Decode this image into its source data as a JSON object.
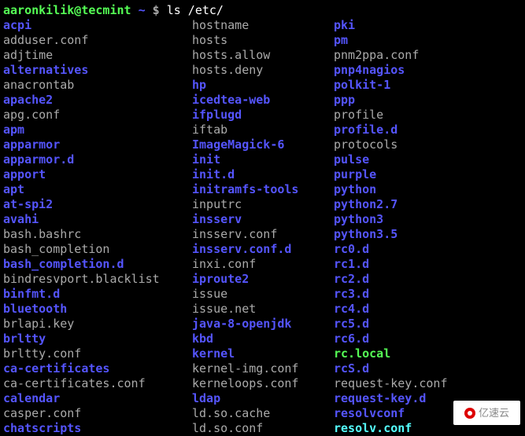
{
  "prompt": {
    "user": "aaronkilik@tecmint",
    "tilde": "~",
    "dollar": "$",
    "command": "ls /etc/"
  },
  "columns": [
    [
      {
        "name": "acpi",
        "cls": "f-dir"
      },
      {
        "name": "adduser.conf",
        "cls": "f-file"
      },
      {
        "name": "adjtime",
        "cls": "f-file"
      },
      {
        "name": "alternatives",
        "cls": "f-dir"
      },
      {
        "name": "anacrontab",
        "cls": "f-file"
      },
      {
        "name": "apache2",
        "cls": "f-dir"
      },
      {
        "name": "apg.conf",
        "cls": "f-file"
      },
      {
        "name": "apm",
        "cls": "f-dir"
      },
      {
        "name": "apparmor",
        "cls": "f-dir"
      },
      {
        "name": "apparmor.d",
        "cls": "f-dir"
      },
      {
        "name": "apport",
        "cls": "f-dir"
      },
      {
        "name": "apt",
        "cls": "f-dir"
      },
      {
        "name": "at-spi2",
        "cls": "f-dir"
      },
      {
        "name": "avahi",
        "cls": "f-dir"
      },
      {
        "name": "bash.bashrc",
        "cls": "f-file"
      },
      {
        "name": "bash_completion",
        "cls": "f-file"
      },
      {
        "name": "bash_completion.d",
        "cls": "f-dir"
      },
      {
        "name": "bindresvport.blacklist",
        "cls": "f-file"
      },
      {
        "name": "binfmt.d",
        "cls": "f-dir"
      },
      {
        "name": "bluetooth",
        "cls": "f-dir"
      },
      {
        "name": "brlapi.key",
        "cls": "f-file"
      },
      {
        "name": "brltty",
        "cls": "f-dir"
      },
      {
        "name": "brltty.conf",
        "cls": "f-file"
      },
      {
        "name": "ca-certificates",
        "cls": "f-dir"
      },
      {
        "name": "ca-certificates.conf",
        "cls": "f-file"
      },
      {
        "name": "calendar",
        "cls": "f-dir"
      },
      {
        "name": "casper.conf",
        "cls": "f-file"
      },
      {
        "name": "chatscripts",
        "cls": "f-dir"
      }
    ],
    [
      {
        "name": "hostname",
        "cls": "f-file"
      },
      {
        "name": "hosts",
        "cls": "f-file"
      },
      {
        "name": "hosts.allow",
        "cls": "f-file"
      },
      {
        "name": "hosts.deny",
        "cls": "f-file"
      },
      {
        "name": "hp",
        "cls": "f-dir"
      },
      {
        "name": "icedtea-web",
        "cls": "f-dir"
      },
      {
        "name": "ifplugd",
        "cls": "f-dir"
      },
      {
        "name": "iftab",
        "cls": "f-file"
      },
      {
        "name": "ImageMagick-6",
        "cls": "f-dir"
      },
      {
        "name": "init",
        "cls": "f-dir"
      },
      {
        "name": "init.d",
        "cls": "f-dir"
      },
      {
        "name": "initramfs-tools",
        "cls": "f-dir"
      },
      {
        "name": "inputrc",
        "cls": "f-file"
      },
      {
        "name": "insserv",
        "cls": "f-dir"
      },
      {
        "name": "insserv.conf",
        "cls": "f-file"
      },
      {
        "name": "insserv.conf.d",
        "cls": "f-dir"
      },
      {
        "name": "inxi.conf",
        "cls": "f-file"
      },
      {
        "name": "iproute2",
        "cls": "f-dir"
      },
      {
        "name": "issue",
        "cls": "f-file"
      },
      {
        "name": "issue.net",
        "cls": "f-file"
      },
      {
        "name": "java-8-openjdk",
        "cls": "f-dir"
      },
      {
        "name": "kbd",
        "cls": "f-dir"
      },
      {
        "name": "kernel",
        "cls": "f-dir"
      },
      {
        "name": "kernel-img.conf",
        "cls": "f-file"
      },
      {
        "name": "kerneloops.conf",
        "cls": "f-file"
      },
      {
        "name": "ldap",
        "cls": "f-dir"
      },
      {
        "name": "ld.so.cache",
        "cls": "f-file"
      },
      {
        "name": "ld.so.conf",
        "cls": "f-file"
      }
    ],
    [
      {
        "name": "pki",
        "cls": "f-dir"
      },
      {
        "name": "pm",
        "cls": "f-dir"
      },
      {
        "name": "pnm2ppa.conf",
        "cls": "f-file"
      },
      {
        "name": "pnp4nagios",
        "cls": "f-dir"
      },
      {
        "name": "polkit-1",
        "cls": "f-dir"
      },
      {
        "name": "ppp",
        "cls": "f-dir"
      },
      {
        "name": "profile",
        "cls": "f-file"
      },
      {
        "name": "profile.d",
        "cls": "f-dir"
      },
      {
        "name": "protocols",
        "cls": "f-file"
      },
      {
        "name": "pulse",
        "cls": "f-dir"
      },
      {
        "name": "purple",
        "cls": "f-dir"
      },
      {
        "name": "python",
        "cls": "f-dir"
      },
      {
        "name": "python2.7",
        "cls": "f-dir"
      },
      {
        "name": "python3",
        "cls": "f-dir"
      },
      {
        "name": "python3.5",
        "cls": "f-dir"
      },
      {
        "name": "rc0.d",
        "cls": "f-dir"
      },
      {
        "name": "rc1.d",
        "cls": "f-dir"
      },
      {
        "name": "rc2.d",
        "cls": "f-dir"
      },
      {
        "name": "rc3.d",
        "cls": "f-dir"
      },
      {
        "name": "rc4.d",
        "cls": "f-dir"
      },
      {
        "name": "rc5.d",
        "cls": "f-dir"
      },
      {
        "name": "rc6.d",
        "cls": "f-dir"
      },
      {
        "name": "rc.local",
        "cls": "f-exec"
      },
      {
        "name": "rcS.d",
        "cls": "f-dir"
      },
      {
        "name": "request-key.conf",
        "cls": "f-file"
      },
      {
        "name": "request-key.d",
        "cls": "f-dir"
      },
      {
        "name": "resolvconf",
        "cls": "f-dir"
      },
      {
        "name": "resolv.conf",
        "cls": "f-link"
      }
    ]
  ],
  "watermark": "亿速云"
}
